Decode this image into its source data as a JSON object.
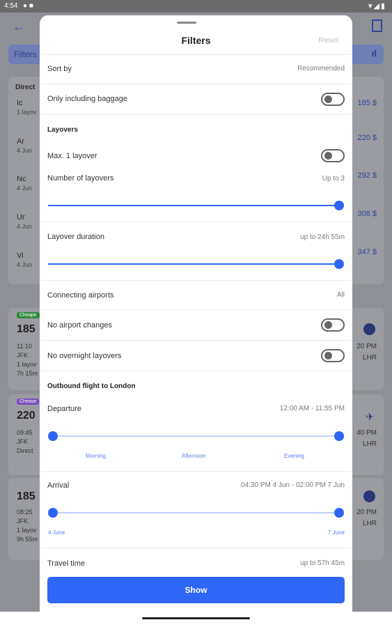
{
  "status_bar": {
    "time": "4:54"
  },
  "background": {
    "filter_label": "Filters",
    "direct_label": "Direct",
    "flights": [
      {
        "airline": "Ic",
        "sub": "1 layov",
        "price": "185 $"
      },
      {
        "airline": "Ar",
        "sub": "4 Jun",
        "price": "220 $"
      },
      {
        "airline": "Nc",
        "sub": "4 Jun",
        "price": "292 $"
      },
      {
        "airline": "Ur",
        "sub": "4 Jun",
        "price": "308 $"
      },
      {
        "airline": "Vi",
        "sub": "4 Jun",
        "price": "347 $"
      }
    ],
    "tickets": [
      {
        "tag": "Cheape",
        "tag_color": "#2f8a3a",
        "price": "185",
        "time": "11:10",
        "from": "JFK",
        "info": "1 layov",
        "extra": "7h 15m",
        "arr_time": "20 PM",
        "to": "LHR"
      },
      {
        "tag": "Chease",
        "tag_color": "#7a4fbf",
        "price": "220",
        "time": "09:45",
        "from": "JFK",
        "info": "Direct",
        "extra": "",
        "arr_time": "40 PM",
        "to": "LHR"
      },
      {
        "tag": "",
        "tag_color": "",
        "price": "185",
        "time": "08:25",
        "from": "JFK",
        "info": "1 layov",
        "extra": "9h 55m",
        "arr_time": "20 PM",
        "to": "LHR"
      }
    ]
  },
  "sheet": {
    "title": "Filters",
    "reset_label": "Reset",
    "sort_by": {
      "label": "Sort by",
      "value": "Recommended"
    },
    "baggage": {
      "label": "Only including baggage",
      "on": false
    },
    "layovers_header": "Layovers",
    "max_one_layover": {
      "label": "Max. 1 layover",
      "on": false
    },
    "number_of_layovers": {
      "label": "Number of layovers",
      "value": "Up to 3",
      "max_level": 1.0
    },
    "layover_duration": {
      "label": "Layover duration",
      "value": "up to 24h 55m",
      "max_level": 1.0
    },
    "connecting_airports": {
      "label": "Connecting airports",
      "value": "All"
    },
    "no_airport_changes": {
      "label": "No airport changes",
      "on": false
    },
    "no_overnight_layovers": {
      "label": "No overnight layovers",
      "on": false
    },
    "outbound_header": "Outbound flight to London",
    "departure": {
      "label": "Departure",
      "value": "12:00 AM - 11:55 PM",
      "min_level": 0.0,
      "max_level": 1.0,
      "ticks": [
        "Morning",
        "Afternoon",
        "Evening"
      ]
    },
    "arrival": {
      "label": "Arrival",
      "value": "04:30 PM 4 Jun - 02:00 PM 7 Jun",
      "min_level": 0.0,
      "max_level": 1.0,
      "start_label": "4 June",
      "end_label": "7 June"
    },
    "travel_time": {
      "label": "Travel time",
      "value": "up to 57h 45m"
    },
    "show_button": "Show"
  },
  "colors": {
    "accent": "#2e66f6",
    "toggle_off": "#666666"
  }
}
